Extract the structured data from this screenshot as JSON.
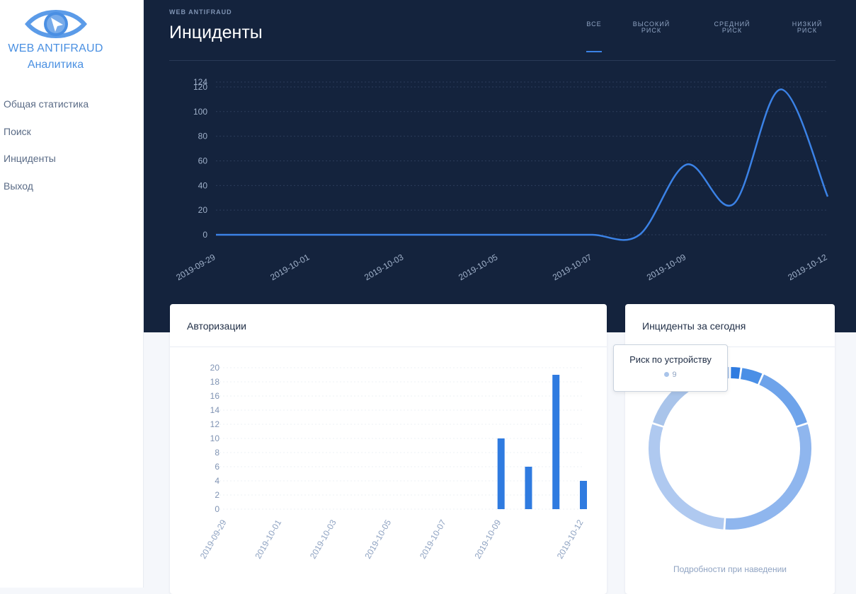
{
  "app": {
    "brand": "WEB ANTIFRAUD",
    "subtitle": "Аналитика"
  },
  "sidebar": {
    "items": [
      {
        "label": "Общая статистика"
      },
      {
        "label": "Поиск"
      },
      {
        "label": "Инциденты"
      },
      {
        "label": "Выход"
      }
    ]
  },
  "header": {
    "eyebrow": "WEB ANTIFRAUD",
    "title": "Инциденты",
    "tabs": [
      {
        "line1": "ВСЕ",
        "line2": "",
        "active": true
      },
      {
        "line1": "ВЫСОКИЙ",
        "line2": "РИСК",
        "active": false
      },
      {
        "line1": "СРЕДНИЙ",
        "line2": "РИСК",
        "active": false
      },
      {
        "line1": "НИЗКИЙ",
        "line2": "РИСК",
        "active": false
      }
    ]
  },
  "colors": {
    "accent": "#3b82e6",
    "hero_bg": "#14233d",
    "bar": "#2f7be0"
  },
  "chart_data": [
    {
      "type": "line",
      "x": [
        "2019-09-29",
        "2019-09-30",
        "2019-10-01",
        "2019-10-02",
        "2019-10-03",
        "2019-10-04",
        "2019-10-05",
        "2019-10-06",
        "2019-10-07",
        "2019-10-08",
        "2019-10-09",
        "2019-10-10",
        "2019-10-11",
        "2019-10-12"
      ],
      "tick_labels": [
        "2019-09-29",
        "2019-10-01",
        "2019-10-03",
        "2019-10-05",
        "2019-10-07",
        "2019-10-09",
        "2019-10-12"
      ],
      "y_ticks": [
        "0",
        "20",
        "40",
        "60",
        "80",
        "100",
        "120",
        "124"
      ],
      "values": [
        0,
        0,
        0,
        0,
        0,
        0,
        0,
        0,
        0,
        0,
        57,
        25,
        118,
        31
      ],
      "ylim": [
        0,
        124
      ],
      "color": "#3b82e6",
      "grid": true
    },
    {
      "type": "bar",
      "title": "Авторизации",
      "x": [
        "2019-09-29",
        "2019-09-30",
        "2019-10-01",
        "2019-10-02",
        "2019-10-03",
        "2019-10-04",
        "2019-10-05",
        "2019-10-06",
        "2019-10-07",
        "2019-10-08",
        "2019-10-09",
        "2019-10-10",
        "2019-10-11",
        "2019-10-12"
      ],
      "tick_labels": [
        "2019-09-29",
        "2019-10-01",
        "2019-10-03",
        "2019-10-05",
        "2019-10-07",
        "2019-10-09",
        "2019-10-12"
      ],
      "y_ticks": [
        "0",
        "2",
        "4",
        "6",
        "8",
        "10",
        "12",
        "14",
        "16",
        "18",
        "20"
      ],
      "values": [
        0,
        0,
        0,
        0,
        0,
        0,
        0,
        0,
        0,
        0,
        10,
        6,
        19,
        4
      ],
      "ylim": [
        0,
        20
      ],
      "color": "#2f7be0",
      "grid": true
    },
    {
      "type": "pie",
      "title": "Инциденты за сегодня",
      "slices": [
        {
          "value": 1,
          "color": "#2f7be0"
        },
        {
          "value": 2,
          "color": "#4a8fe6"
        },
        {
          "value": 6,
          "color": "#6ea3ea"
        },
        {
          "value": 14,
          "color": "#8fb6ee"
        },
        {
          "value": 13,
          "color": "#afc9f0"
        },
        {
          "value": 9,
          "color": "#a9c4ea"
        }
      ]
    }
  ],
  "tooltip": {
    "title": "Риск по устройству",
    "value": "9"
  },
  "hint": "Подробности при наведении"
}
